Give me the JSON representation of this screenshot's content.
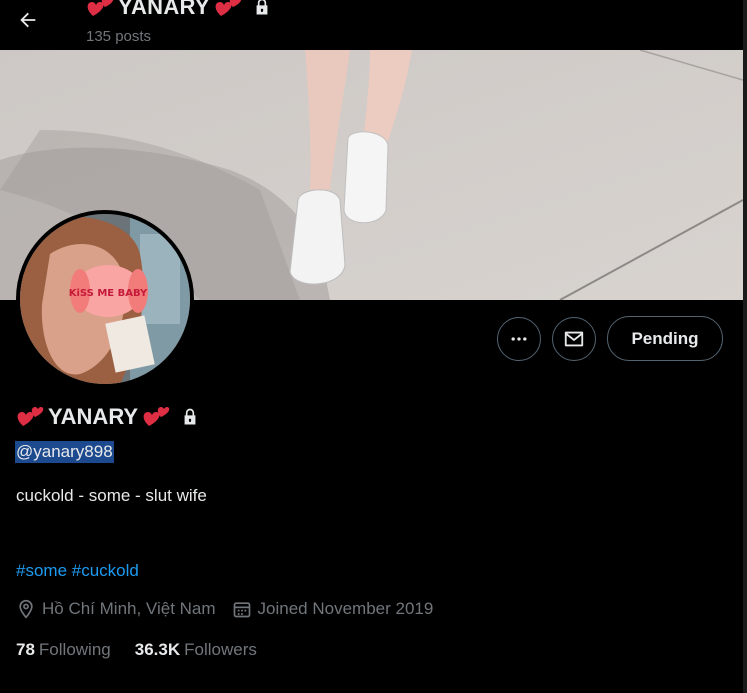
{
  "header": {
    "back_label": "Back",
    "title": "YANARY",
    "posts_count": "135 posts"
  },
  "profile": {
    "display_name": "YANARY",
    "handle": "@yanary898",
    "bio": "cuckold - some - slut wife",
    "hashtags": [
      "#some",
      "#cuckold"
    ],
    "location": "Hồ Chí Minh, Việt Nam",
    "joined": "Joined November 2019",
    "following_count": "78",
    "following_label": "Following",
    "followers_count": "36.3K",
    "followers_label": "Followers",
    "avatar_sticker_text": "KiSS ME BABY"
  },
  "actions": {
    "more": "More",
    "message": "Message",
    "pending": "Pending"
  },
  "icons": [
    "back-arrow-icon",
    "heart-icon",
    "lock-icon",
    "more-icon",
    "mail-icon",
    "location-icon",
    "calendar-icon"
  ],
  "colors": {
    "background": "#000000",
    "text": "#e7e9ea",
    "muted": "#71767b",
    "link": "#1d9bf0",
    "heart": "#e0245e",
    "selection": "#1d4a8f"
  }
}
